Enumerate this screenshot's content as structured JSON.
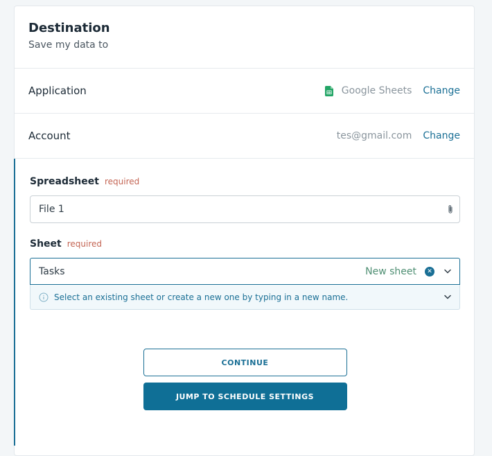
{
  "header": {
    "title": "Destination",
    "subtitle": "Save my data to"
  },
  "application": {
    "label": "Application",
    "value": "Google Sheets",
    "icon": "google-sheets-icon",
    "change_label": "Change"
  },
  "account": {
    "label": "Account",
    "value": "tes@gmail.com",
    "change_label": "Change"
  },
  "spreadsheet": {
    "label": "Spreadsheet",
    "required_label": "required",
    "value": "File 1"
  },
  "sheet": {
    "label": "Sheet",
    "required_label": "required",
    "value": "Tasks",
    "new_sheet_label": "New sheet",
    "hint": "Select an existing sheet or create a new one by typing in a new name."
  },
  "actions": {
    "continue_label": "CONTINUE",
    "jump_label": "JUMP TO SCHEDULE SETTINGS"
  },
  "colors": {
    "accent": "#1a6f95",
    "required": "#c46554",
    "new_sheet": "#4f8f73",
    "sheets_green": "#23a566"
  }
}
